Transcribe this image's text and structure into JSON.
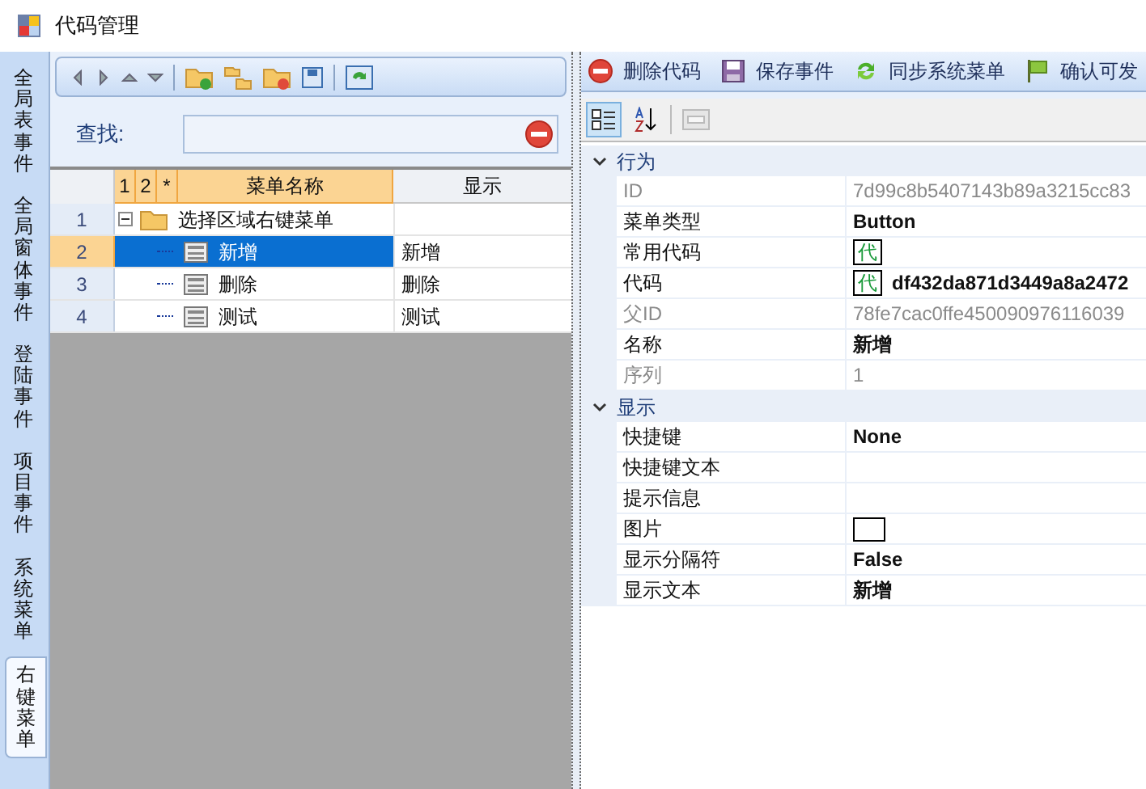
{
  "window": {
    "title": "代码管理"
  },
  "side_tabs": [
    {
      "label": "全局表事件",
      "selected": false
    },
    {
      "label": "全局窗体事件",
      "selected": false
    },
    {
      "label": "登陆事件",
      "selected": false
    },
    {
      "label": "项目事件",
      "selected": false
    },
    {
      "label": "系统菜单",
      "selected": false
    },
    {
      "label": "右键菜单",
      "selected": true
    }
  ],
  "search": {
    "label": "查找:"
  },
  "grid": {
    "columns": [
      "1",
      "2",
      "*",
      "菜单名称",
      "显示"
    ],
    "rows": [
      {
        "number": "1",
        "name": "选择区域右键菜单",
        "kind": "folder",
        "expanded": true,
        "selected": false,
        "children": [
          {
            "number": "2",
            "name": "新增",
            "display": "新增",
            "kind": "item",
            "selected": true
          },
          {
            "number": "3",
            "name": "删除",
            "display": "删除",
            "kind": "item",
            "selected": false
          },
          {
            "number": "4",
            "name": "测试",
            "display": "测试",
            "kind": "item",
            "selected": false
          }
        ]
      }
    ]
  },
  "actions": [
    {
      "label": "删除代码",
      "kind": "delete"
    },
    {
      "label": "保存事件",
      "kind": "save"
    },
    {
      "label": "同步系统菜单",
      "kind": "sync"
    },
    {
      "label": "确认可发",
      "kind": "flag"
    }
  ],
  "property_toolbar": {
    "categorized": true,
    "alphabetical": false,
    "pages_disabled": true
  },
  "properties": [
    {
      "name": "行为",
      "expanded": true,
      "rows": [
        {
          "name": "ID",
          "value": "7d99c8b5407143b89a3215cc83",
          "readonly": true
        },
        {
          "name": "菜单类型",
          "value": "Button",
          "readonly": false
        },
        {
          "name": "常用代码",
          "badge": "代",
          "readonly": false
        },
        {
          "name": "代码",
          "badge": "代",
          "value": "df432da871d3449a8a2472",
          "readonly": false
        },
        {
          "name": "父ID",
          "value": "78fe7cac0ffe450090976116039",
          "readonly": true
        },
        {
          "name": "名称",
          "value": "新增",
          "readonly": false
        },
        {
          "name": "序列",
          "value": "1",
          "readonly": true
        }
      ]
    },
    {
      "name": "显示",
      "expanded": true,
      "rows": [
        {
          "name": "快捷键",
          "value": "None",
          "readonly": false
        },
        {
          "name": "快捷键文本",
          "readonly": false
        },
        {
          "name": "提示信息",
          "readonly": false
        },
        {
          "name": "图片",
          "swatch": true,
          "readonly": false
        },
        {
          "name": "显示分隔符",
          "value": "False",
          "readonly": false
        },
        {
          "name": "显示文本",
          "value": "新增",
          "readonly": false
        }
      ]
    }
  ]
}
